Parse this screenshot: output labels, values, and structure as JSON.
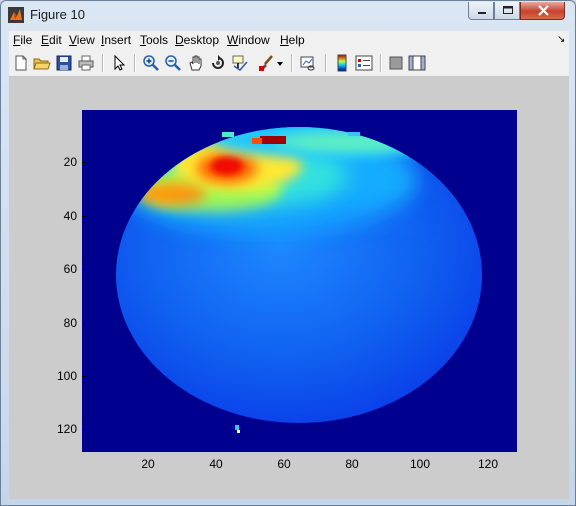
{
  "window": {
    "title": "Figure 10"
  },
  "menu": [
    {
      "u": "F",
      "rest": "ile"
    },
    {
      "u": "E",
      "rest": "dit"
    },
    {
      "u": "V",
      "rest": "iew"
    },
    {
      "u": "I",
      "rest": "nsert"
    },
    {
      "u": "T",
      "rest": "ools"
    },
    {
      "u": "D",
      "rest": "esktop"
    },
    {
      "u": "W",
      "rest": "indow"
    },
    {
      "u": "H",
      "rest": "elp"
    }
  ],
  "toolbar": [
    "new-file-icon",
    "open-folder-icon",
    "save-icon",
    "print-icon",
    "select-arrow-icon",
    "zoom-in-icon",
    "zoom-out-icon",
    "pan-hand-icon",
    "rotate-3d-icon",
    "data-cursor-icon",
    "brush-icon",
    "brush-dropdown-icon",
    "link-plot-icon",
    "colorbar-icon",
    "legend-icon",
    "hide-plot-tools-icon",
    "show-plot-tools-icon"
  ],
  "axes": {
    "y_ticks": [
      "20",
      "40",
      "60",
      "80",
      "100",
      "120"
    ],
    "x_ticks": [
      "20",
      "40",
      "60",
      "80",
      "100",
      "120"
    ]
  },
  "chart_data": {
    "type": "heatmap",
    "title": "",
    "xlabel": "",
    "ylabel": "",
    "xlim": [
      0.5,
      128.5
    ],
    "ylim": [
      0.5,
      128.5
    ],
    "y_direction": "reverse",
    "colormap": "jet",
    "grid": false,
    "hotspots": [
      {
        "x": 45,
        "y": 23,
        "level": 0.92
      },
      {
        "x": 54,
        "y": 11,
        "level": 1.0
      },
      {
        "x": 35,
        "y": 30,
        "level": 0.85
      }
    ]
  }
}
